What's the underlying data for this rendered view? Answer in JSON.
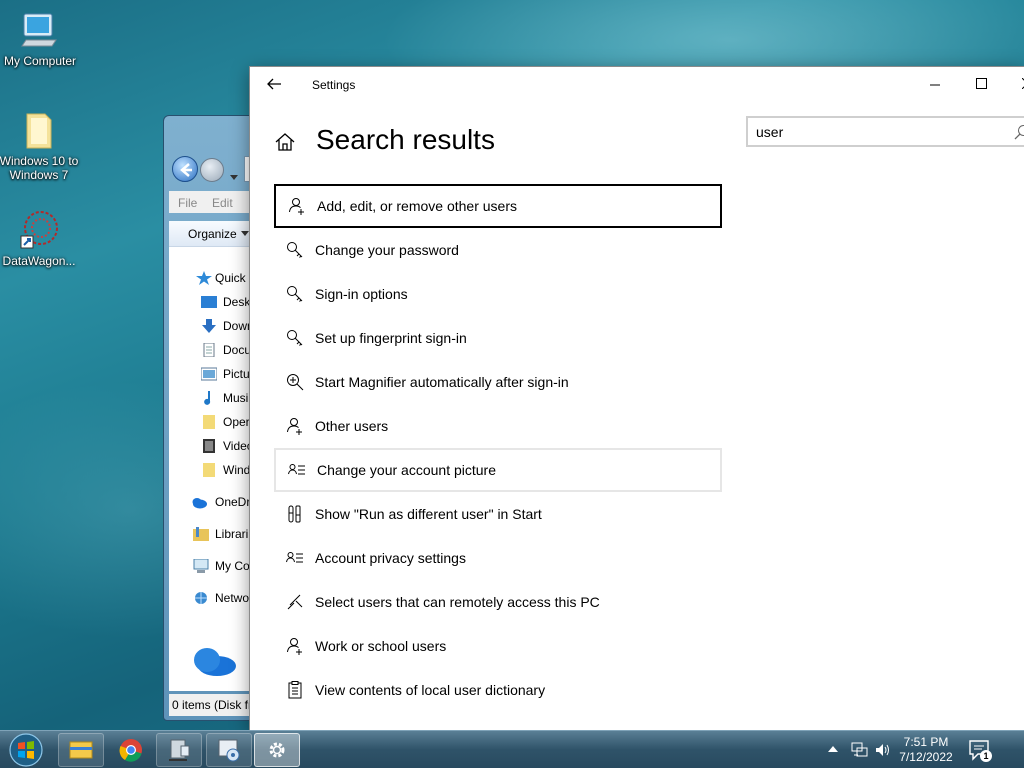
{
  "desktop": {
    "icons": [
      {
        "label": "My Computer",
        "icon": "computer-icon"
      },
      {
        "label": "Windows 10 to Windows 7",
        "icon": "folder-icon"
      },
      {
        "label": "DataWagon...",
        "icon": "datawagon-icon"
      }
    ]
  },
  "explorer": {
    "menu": [
      "File",
      "Edit"
    ],
    "toolbar_label": "Organize",
    "nav": [
      {
        "label": "Quick",
        "icon": "star-icon"
      },
      {
        "label": "Deskt",
        "icon": "desktop-icon"
      },
      {
        "label": "Down",
        "icon": "download-icon"
      },
      {
        "label": "Docu",
        "icon": "document-icon"
      },
      {
        "label": "Pictu",
        "icon": "picture-icon"
      },
      {
        "label": "Musi",
        "icon": "music-icon"
      },
      {
        "label": "Oper",
        "icon": "folder-icon"
      },
      {
        "label": "Video",
        "icon": "video-icon"
      },
      {
        "label": "Wind",
        "icon": "folder-icon"
      },
      {
        "label": "OneDr",
        "icon": "onedrive-icon"
      },
      {
        "label": "Librari",
        "icon": "libraries-icon"
      },
      {
        "label": "My Co",
        "icon": "computer-icon"
      },
      {
        "label": "Netwo",
        "icon": "network-icon"
      }
    ],
    "status": "0 items (Disk fr"
  },
  "settings": {
    "window_title": "Settings",
    "page_title": "Search results",
    "search": {
      "value": "user",
      "placeholder": ""
    },
    "results": [
      {
        "label": "Add, edit, or remove other users",
        "icon": "add-user-icon",
        "state": "focused"
      },
      {
        "label": "Change your password",
        "icon": "key-icon"
      },
      {
        "label": "Sign-in options",
        "icon": "key-icon"
      },
      {
        "label": "Set up fingerprint sign-in",
        "icon": "key-icon"
      },
      {
        "label": "Start Magnifier automatically after sign-in",
        "icon": "magnifier-icon"
      },
      {
        "label": "Other users",
        "icon": "add-user-icon"
      },
      {
        "label": "Change your account picture",
        "icon": "account-info-icon",
        "state": "hovered"
      },
      {
        "label": "Show \"Run as different user\" in Start",
        "icon": "tools-icon"
      },
      {
        "label": "Account privacy settings",
        "icon": "account-info-icon"
      },
      {
        "label": "Select users that can remotely access this PC",
        "icon": "remote-desktop-icon"
      },
      {
        "label": "Work or school users",
        "icon": "add-user-icon"
      },
      {
        "label": "View contents of local user dictionary",
        "icon": "clipboard-icon"
      }
    ]
  },
  "taskbar": {
    "apps": [
      "file-explorer-icon",
      "chrome-icon",
      "remote-icon",
      "control-panel-icon",
      "settings-gear-icon"
    ],
    "time": "7:51 PM",
    "date": "7/12/2022",
    "notification_count": "1"
  },
  "colors": {
    "accent": "#0078d7",
    "taskbar": "#2f5369"
  }
}
